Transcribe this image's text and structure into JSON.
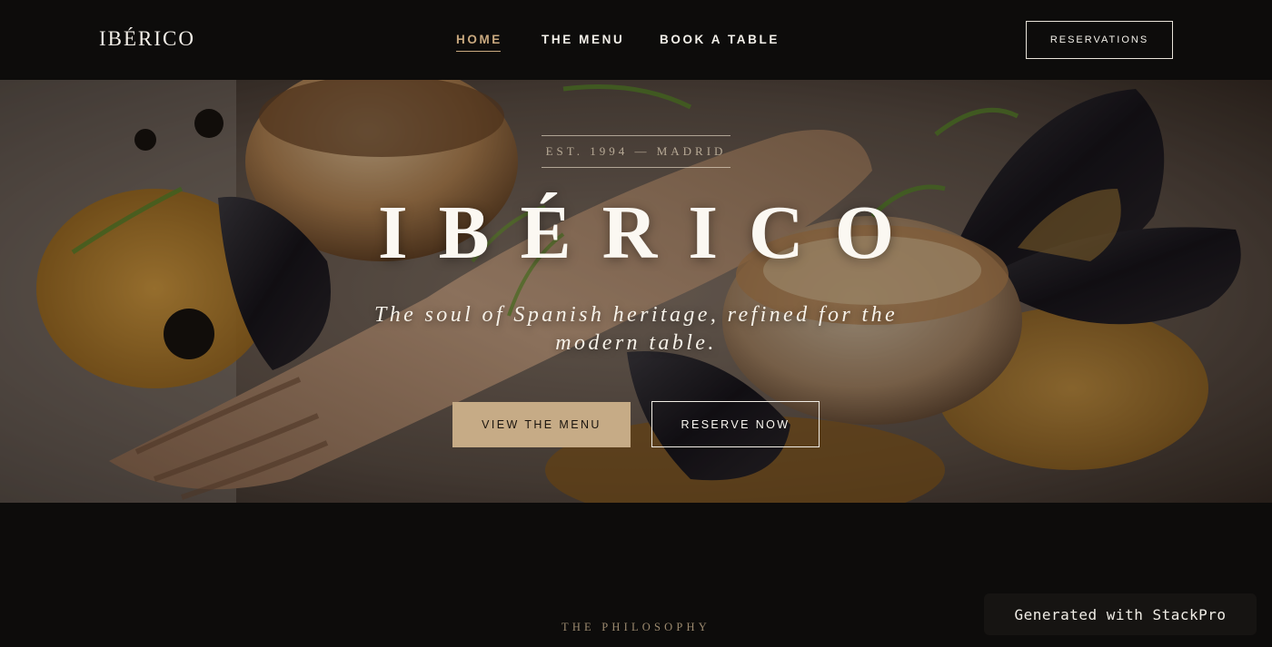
{
  "brand": {
    "logo": "IBÉRICO"
  },
  "nav": {
    "links": [
      {
        "label": "HOME",
        "active": true
      },
      {
        "label": "THE MENU",
        "active": false
      },
      {
        "label": "BOOK A TABLE",
        "active": false
      }
    ],
    "reservations_label": "RESERVATIONS"
  },
  "hero": {
    "established": "EST. 1994 — MADRID",
    "title": "IBÉRICO",
    "tagline": "The soul of Spanish heritage, refined for the modern table.",
    "primary_cta": "VIEW THE MENU",
    "secondary_cta": "RESERVE NOW",
    "image": "plated-seafood-scallops-mussels-prawn"
  },
  "philosophy": {
    "eyebrow": "THE PHILOSOPHY"
  },
  "badge": {
    "label": "Generated with StackPro"
  },
  "colors": {
    "background": "#0d0c0b",
    "accent_gold": "#c9a97f",
    "button_gold": "#c6ab86",
    "text_light": "#f4f1ea"
  }
}
